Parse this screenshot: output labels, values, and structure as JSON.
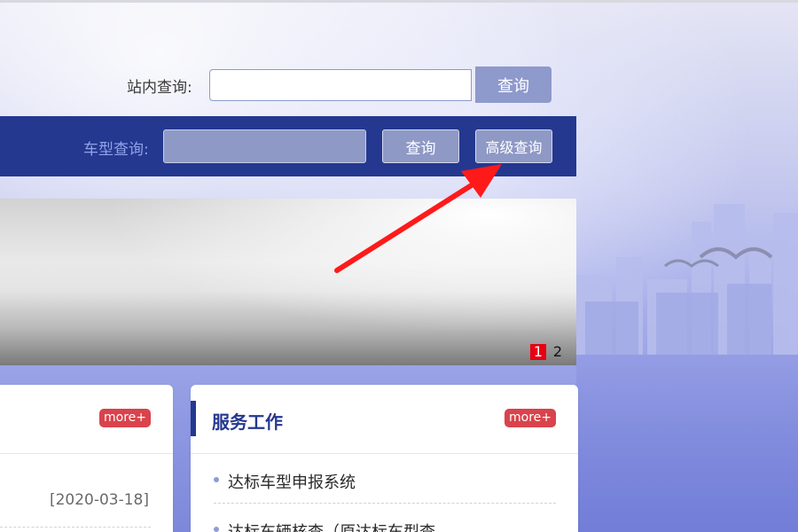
{
  "site_search": {
    "label": "站内查询:",
    "input_value": "",
    "button": "查询"
  },
  "model_search": {
    "label": "车型查询:",
    "input_value": "",
    "search_button": "查询",
    "advanced_button": "高级查询"
  },
  "banner": {
    "pages": [
      "1",
      "2"
    ],
    "active_page": "1"
  },
  "news_card": {
    "more": "more+",
    "items": [
      {
        "date": "[2020-03-18]"
      }
    ]
  },
  "service_card": {
    "title": "服务工作",
    "more": "more+",
    "items": [
      {
        "label": "达标车型申报系统"
      },
      {
        "label": "达标车辆核查（原达标车型查"
      }
    ]
  },
  "colors": {
    "nav_blue": "#24388f",
    "more_red": "#d9434c",
    "pager_active": "#e60012",
    "annotation_arrow": "#ff1a1a"
  }
}
